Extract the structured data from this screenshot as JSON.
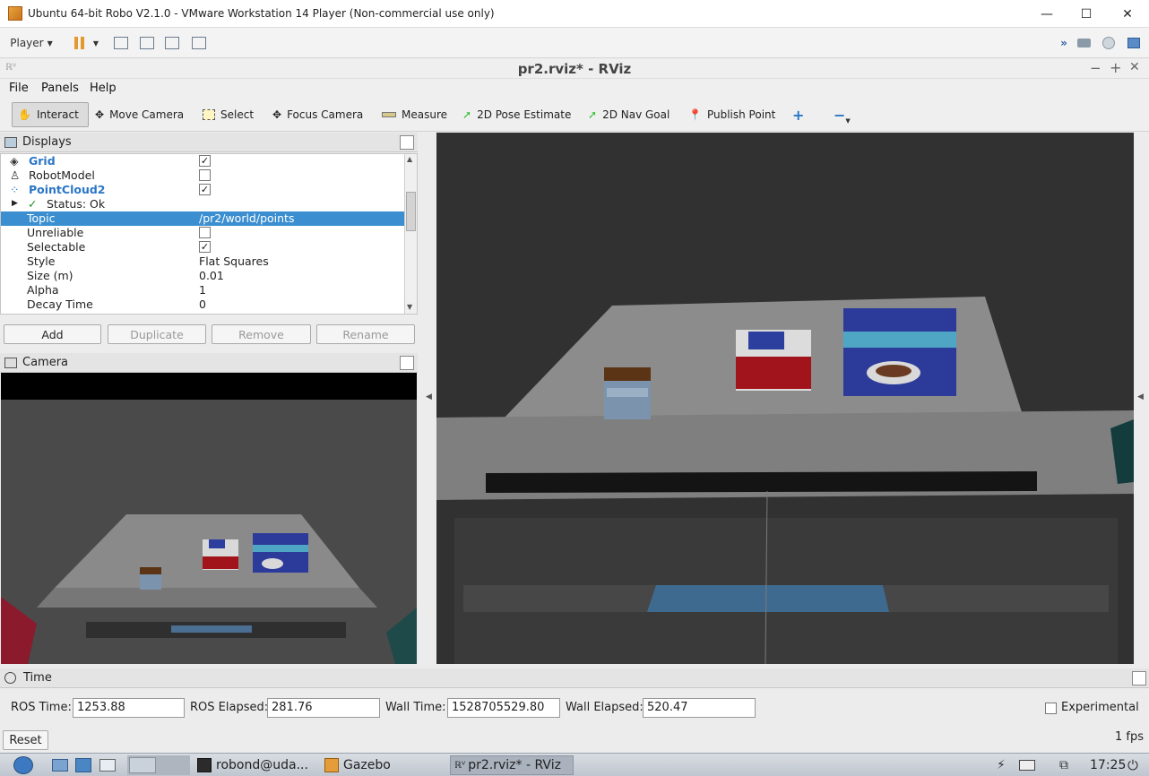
{
  "vmware": {
    "title": "Ubuntu 64-bit Robo V2.1.0 - VMware Workstation 14 Player (Non-commercial use only)",
    "player_label": "Player",
    "minimize": "—",
    "maximize": "☐",
    "close": "✕"
  },
  "rviz": {
    "title": "pr2.rviz* - RViz",
    "menus": [
      "File",
      "Panels",
      "Help"
    ],
    "tools": [
      {
        "label": "Interact",
        "icon": "hand-icon"
      },
      {
        "label": "Move Camera",
        "icon": "move-icon"
      },
      {
        "label": "Select",
        "icon": "select-icon"
      },
      {
        "label": "Focus Camera",
        "icon": "focus-icon"
      },
      {
        "label": "Measure",
        "icon": "ruler-icon"
      },
      {
        "label": "2D Pose Estimate",
        "icon": "arrow-icon"
      },
      {
        "label": "2D Nav Goal",
        "icon": "arrow-icon"
      },
      {
        "label": "Publish Point",
        "icon": "pin-icon"
      }
    ],
    "accent": "#3b8fd0"
  },
  "displays": {
    "header": "Displays",
    "items": [
      {
        "name": "Grid",
        "checked": true
      },
      {
        "name": "RobotModel",
        "checked": false
      },
      {
        "name": "PointCloud2",
        "checked": true
      }
    ],
    "status": "Status: Ok",
    "properties": [
      {
        "name": "Topic",
        "value": "/pr2/world/points"
      },
      {
        "name": "Unreliable",
        "value": ""
      },
      {
        "name": "Selectable",
        "value": "✓"
      },
      {
        "name": "Style",
        "value": "Flat Squares"
      },
      {
        "name": "Size (m)",
        "value": "0.01"
      },
      {
        "name": "Alpha",
        "value": "1"
      },
      {
        "name": "Decay Time",
        "value": "0"
      }
    ],
    "buttons": {
      "add": "Add",
      "duplicate": "Duplicate",
      "remove": "Remove",
      "rename": "Rename"
    }
  },
  "camera": {
    "header": "Camera"
  },
  "time": {
    "header": "Time",
    "ros_time_label": "ROS Time:",
    "ros_time": "1253.88",
    "ros_elapsed_label": "ROS Elapsed:",
    "ros_elapsed": "281.76",
    "wall_time_label": "Wall Time:",
    "wall_time": "1528705529.80",
    "wall_elapsed_label": "Wall Elapsed:",
    "wall_elapsed": "520.47",
    "experimental_label": "Experimental",
    "reset_label": "Reset",
    "fps": "1 fps"
  },
  "taskbar": {
    "terminal": "robond@uda...",
    "gazebo": "Gazebo",
    "rviz": "pr2.rviz* - RViz",
    "clock": "17:25"
  }
}
